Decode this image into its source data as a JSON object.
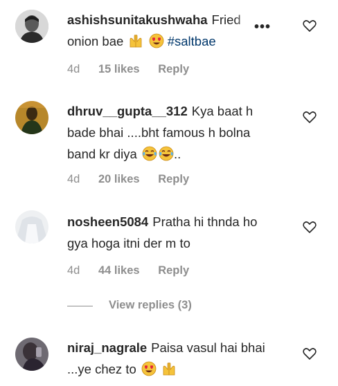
{
  "comments": [
    {
      "username": "ashishsunitakushwaha",
      "text": "Fried onion bae",
      "text_line1": "Fried",
      "text_line2": "onion bae",
      "hashtag": "#saltbae",
      "emojis": [
        "raised-hands-emoji",
        "heart-eyes-emoji"
      ],
      "age": "4d",
      "likes": "15 likes",
      "reply": "Reply",
      "more": "•••"
    },
    {
      "username": "dhruv__gupta__312",
      "text": "Kya baat h bade bhai ....bht famous h bolna band kr diya",
      "text_line1": "Kya baat h",
      "text_line2": "bade bhai ....bht famous h bolna",
      "text_line3": "band kr diya",
      "text_end": "..",
      "emojis": [
        "tears-of-joy-emoji",
        "tears-of-joy-emoji"
      ],
      "age": "4d",
      "likes": "20 likes",
      "reply": "Reply"
    },
    {
      "username": "nosheen5084",
      "text": "Pratha hi thnda ho gya hoga itni der m to",
      "text_line1": "Pratha hi thnda ho",
      "text_line2": "gya hoga itni der m to",
      "age": "4d",
      "likes": "44 likes",
      "reply": "Reply"
    },
    {
      "username": "niraj_nagrale",
      "text": "Paisa vasul hai bhai ...ye chez to",
      "text_line1": "Paisa vasul hai bhai",
      "text_line2": "...ye chez to",
      "emojis": [
        "heart-eyes-emoji",
        "raised-hands-emoji"
      ]
    }
  ],
  "view_replies": "View replies (3)",
  "colors": {
    "text": "#262626",
    "muted": "#8e8e8e",
    "hashtag": "#00376b"
  }
}
